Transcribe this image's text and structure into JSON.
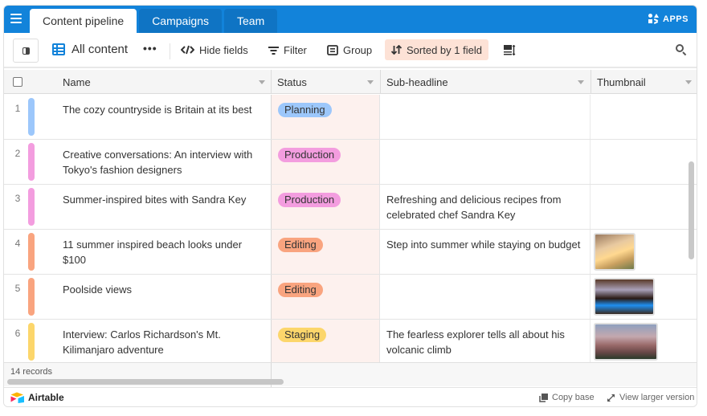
{
  "header": {
    "tabs": [
      {
        "label": "Content pipeline",
        "active": true
      },
      {
        "label": "Campaigns",
        "active": false
      },
      {
        "label": "Team",
        "active": false
      }
    ],
    "apps_label": "APPS",
    "accent_color": "#1283da"
  },
  "toolbar": {
    "view_name": "All content",
    "more_label": "•••",
    "hide_fields_label": "Hide fields",
    "filter_label": "Filter",
    "group_label": "Group",
    "sort_label": "Sorted by 1 field"
  },
  "columns": [
    {
      "label": "Name"
    },
    {
      "label": "Status"
    },
    {
      "label": "Sub-headline"
    },
    {
      "label": "Thumbnail"
    }
  ],
  "rows": [
    {
      "num": "1",
      "name": "The cozy countryside is Britain at its best",
      "status": "Planning",
      "status_color": "#9cc7fb",
      "bar_color": "#9cc7fb",
      "sub": "",
      "thumb": ""
    },
    {
      "num": "2",
      "name": "Creative conversations: An interview with Tokyo's fashion designers",
      "status": "Production",
      "status_color": "#f39ddf",
      "bar_color": "#f39ddf",
      "sub": "",
      "thumb": ""
    },
    {
      "num": "3",
      "name": "Summer-inspired bites with Sandra Key",
      "status": "Production",
      "status_color": "#f39ddf",
      "bar_color": "#f39ddf",
      "sub": "Refreshing and delicious recipes from celebrated chef Sandra Key",
      "thumb": ""
    },
    {
      "num": "4",
      "name": "11 summer inspired beach looks under $100",
      "status": "Editing",
      "status_color": "#f9a47f",
      "bar_color": "#f9a47f",
      "sub": "Step into summer while staying on budget",
      "thumb": "beach-hat-photo"
    },
    {
      "num": "5",
      "name": "Poolside views",
      "status": "Editing",
      "status_color": "#f9a47f",
      "bar_color": "#f9a47f",
      "sub": "",
      "thumb": "poolside-photo"
    },
    {
      "num": "6",
      "name": "Interview: Carlos Richardson's Mt. Kilimanjaro adventure",
      "status": "Staging",
      "status_color": "#fcd66b",
      "bar_color": "#fcd66b",
      "sub": "The fearless explorer tells all about his volcanic climb",
      "thumb": "mountain-photo"
    }
  ],
  "footer": {
    "records": "14 records",
    "brand": "Airtable",
    "copy_base": "Copy base",
    "view_larger": "View larger version"
  }
}
